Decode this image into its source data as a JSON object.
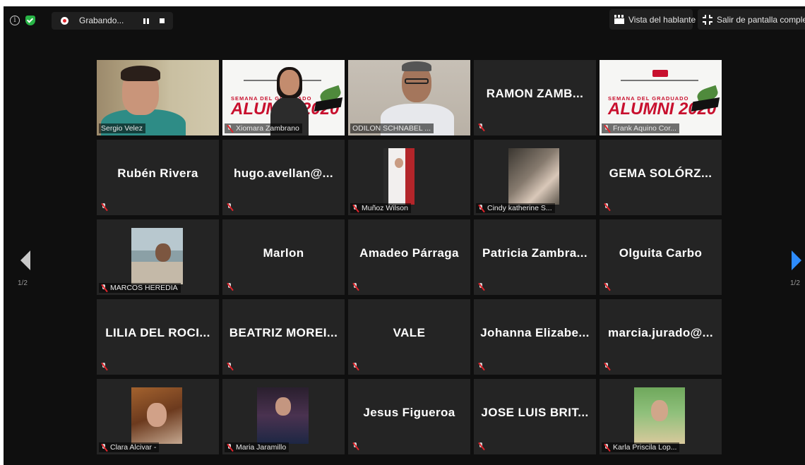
{
  "topbar": {
    "recording_label": "Grabando...",
    "speaker_view_label": "Vista del hablante",
    "exit_fullscreen_label": "Salir de pantalla completa"
  },
  "pagination": {
    "left_indicator": "1/2",
    "right_indicator": "1/2"
  },
  "colors": {
    "active_speaker_border": "#dfe86a",
    "next_page_arrow": "#2d8cff",
    "recording_dot": "#e0242b"
  },
  "participants": [
    {
      "name": "Sergio Velez",
      "label": "Sergio Velez"
    },
    {
      "name": "Xiomara Zambrano",
      "label": "Xiomara Zambrano"
    },
    {
      "name": "ODILON SCHNABEL ...",
      "label": "ODILON SCHNABEL ..."
    },
    {
      "name": "RAMON ZAMB...",
      "label": ""
    },
    {
      "name": "Frank Aquino Cor...",
      "label": "Frank Aquino Cor..."
    },
    {
      "name": "Rubén Rivera",
      "label": ""
    },
    {
      "name": "hugo.avellan@...",
      "label": ""
    },
    {
      "name": "Muñoz Wilson",
      "label": "Muñoz Wilson"
    },
    {
      "name": "Cindy katherine S...",
      "label": "Cindy katherine S..."
    },
    {
      "name": "GEMA SOLÓRZ...",
      "label": ""
    },
    {
      "name": "MARCOS HEREDIA",
      "label": "MARCOS HEREDIA"
    },
    {
      "name": "Marlon",
      "label": ""
    },
    {
      "name": "Amadeo Párraga",
      "label": ""
    },
    {
      "name": "Patricia Zambra...",
      "label": ""
    },
    {
      "name": "Olguita Carbo",
      "label": ""
    },
    {
      "name": "LILIA DEL ROCI...",
      "label": ""
    },
    {
      "name": "BEATRIZ MOREI...",
      "label": ""
    },
    {
      "name": "VALE",
      "label": ""
    },
    {
      "name": "Johanna Elizabe...",
      "label": ""
    },
    {
      "name": "marcia.jurado@...",
      "label": ""
    },
    {
      "name": "Clara Alcivar -",
      "label": "Clara Alcivar -"
    },
    {
      "name": "Maria Jaramillo",
      "label": "Maria Jaramillo"
    },
    {
      "name": "Jesus Figueroa",
      "label": ""
    },
    {
      "name": "JOSE LUIS BRIT...",
      "label": ""
    },
    {
      "name": "Karla Priscila Lop...",
      "label": "Karla Priscila Lop..."
    }
  ],
  "banner": {
    "line1": "SEMANA DEL GRADUADO",
    "line2": "ALUMNI 2020"
  }
}
